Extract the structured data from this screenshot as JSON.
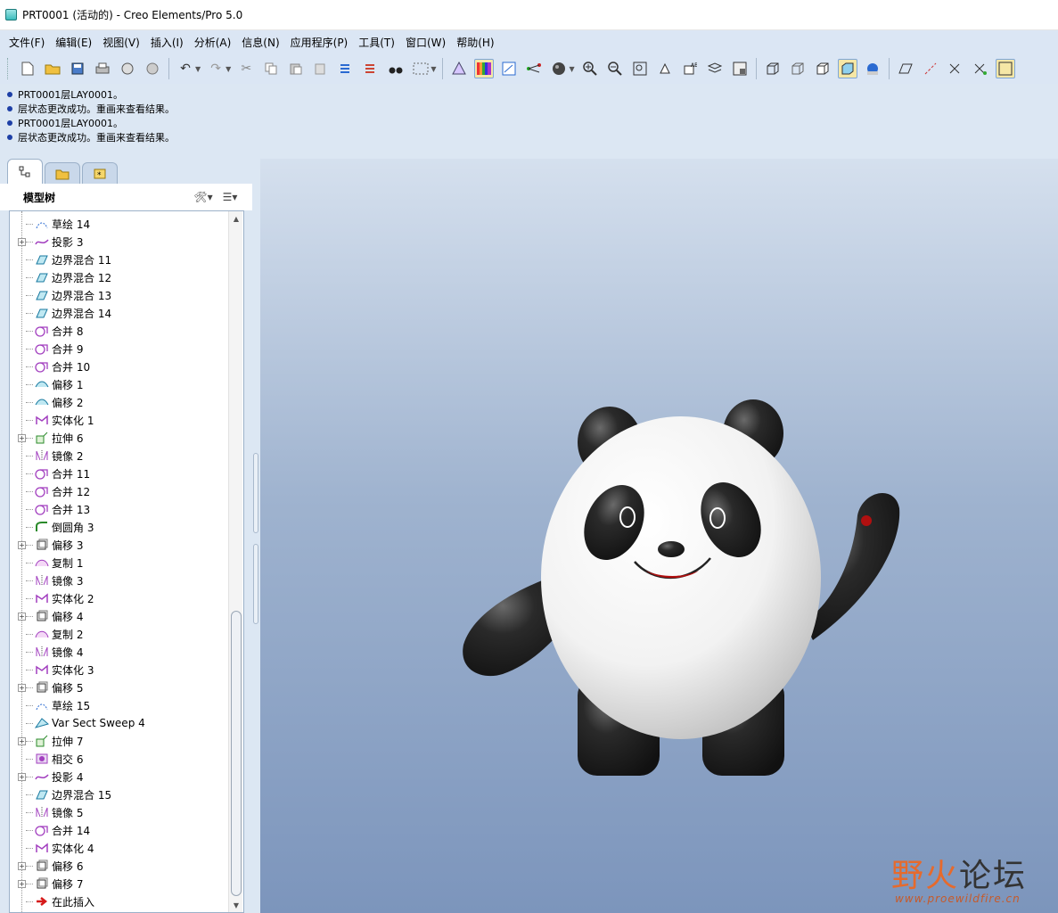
{
  "window": {
    "title": "PRT0001 (活动的) - Creo Elements/Pro 5.0"
  },
  "menubar": [
    "文件(F)",
    "编辑(E)",
    "视图(V)",
    "插入(I)",
    "分析(A)",
    "信息(N)",
    "应用程序(P)",
    "工具(T)",
    "窗口(W)",
    "帮助(H)"
  ],
  "messages": [
    "PRT0001层LAY0001。",
    "层状态更改成功。重画来查看结果。",
    "PRT0001层LAY0001。",
    "层状态更改成功。重画来查看结果。"
  ],
  "panel": {
    "title": "模型树"
  },
  "tree": [
    {
      "label": "草绘 14",
      "icon": "sketch-icon",
      "expandable": false
    },
    {
      "label": "投影 3",
      "icon": "projection-icon",
      "expandable": true
    },
    {
      "label": "边界混合 11",
      "icon": "boundary-blend-icon",
      "expandable": false
    },
    {
      "label": "边界混合 12",
      "icon": "boundary-blend-icon",
      "expandable": false
    },
    {
      "label": "边界混合 13",
      "icon": "boundary-blend-icon",
      "expandable": false
    },
    {
      "label": "边界混合 14",
      "icon": "boundary-blend-icon",
      "expandable": false
    },
    {
      "label": "合并 8",
      "icon": "merge-icon",
      "expandable": false
    },
    {
      "label": "合并 9",
      "icon": "merge-icon",
      "expandable": false
    },
    {
      "label": "合并 10",
      "icon": "merge-icon",
      "expandable": false
    },
    {
      "label": "偏移 1",
      "icon": "offset-surface-icon",
      "expandable": false
    },
    {
      "label": "偏移 2",
      "icon": "offset-surface-icon",
      "expandable": false
    },
    {
      "label": "实体化 1",
      "icon": "solidify-icon",
      "expandable": false
    },
    {
      "label": "拉伸 6",
      "icon": "extrude-icon",
      "expandable": true
    },
    {
      "label": "镜像 2",
      "icon": "mirror-icon",
      "expandable": false
    },
    {
      "label": "合并 11",
      "icon": "merge-icon",
      "expandable": false
    },
    {
      "label": "合并 12",
      "icon": "merge-icon",
      "expandable": false
    },
    {
      "label": "合并 13",
      "icon": "merge-icon",
      "expandable": false
    },
    {
      "label": "倒圆角 3",
      "icon": "round-icon",
      "expandable": false
    },
    {
      "label": "偏移 3",
      "icon": "offset-solid-icon",
      "expandable": true
    },
    {
      "label": "复制 1",
      "icon": "copy-icon",
      "expandable": false
    },
    {
      "label": "镜像 3",
      "icon": "mirror-icon",
      "expandable": false
    },
    {
      "label": "实体化 2",
      "icon": "solidify-icon",
      "expandable": false
    },
    {
      "label": "偏移 4",
      "icon": "offset-solid-icon",
      "expandable": true
    },
    {
      "label": "复制 2",
      "icon": "copy-icon",
      "expandable": false
    },
    {
      "label": "镜像 4",
      "icon": "mirror-icon",
      "expandable": false
    },
    {
      "label": "实体化 3",
      "icon": "solidify-icon",
      "expandable": false
    },
    {
      "label": "偏移 5",
      "icon": "offset-solid-icon",
      "expandable": true
    },
    {
      "label": "草绘 15",
      "icon": "sketch-icon",
      "expandable": false
    },
    {
      "label": "Var Sect Sweep 4",
      "icon": "sweep-icon",
      "expandable": false
    },
    {
      "label": "拉伸 7",
      "icon": "extrude-icon",
      "expandable": true
    },
    {
      "label": "相交 6",
      "icon": "intersect-icon",
      "expandable": false
    },
    {
      "label": "投影 4",
      "icon": "projection-icon",
      "expandable": true
    },
    {
      "label": "边界混合 15",
      "icon": "boundary-blend-icon",
      "expandable": false
    },
    {
      "label": "镜像 5",
      "icon": "mirror-icon",
      "expandable": false
    },
    {
      "label": "合并 14",
      "icon": "merge-icon",
      "expandable": false
    },
    {
      "label": "实体化 4",
      "icon": "solidify-icon",
      "expandable": false
    },
    {
      "label": "偏移 6",
      "icon": "offset-solid-icon",
      "expandable": true
    },
    {
      "label": "偏移 7",
      "icon": "offset-solid-icon",
      "expandable": true
    },
    {
      "label": "在此插入",
      "icon": "insert-here-arrow-icon",
      "expandable": false
    }
  ],
  "watermark": {
    "title_a": "野火",
    "title_b": "论坛",
    "url": "www.proewildfire.cn"
  },
  "colors": {
    "accent_blue": "#1d3fa6",
    "viewport_top": "#d5e0ee",
    "viewport_bottom": "#7c95bc",
    "watermark": "#e66a2c"
  }
}
